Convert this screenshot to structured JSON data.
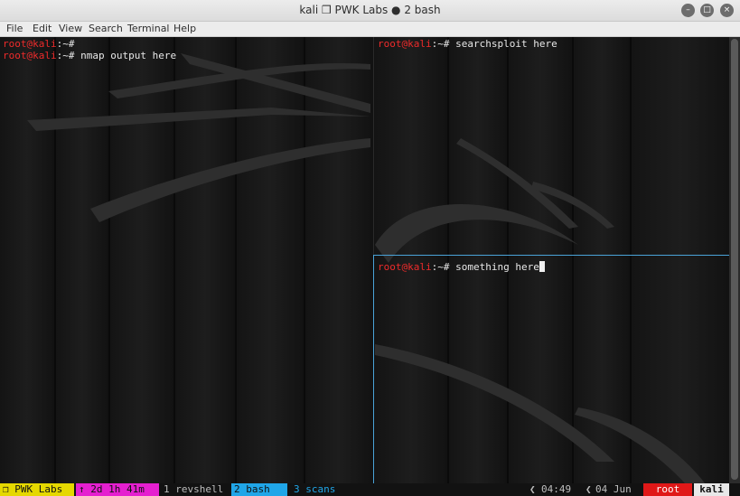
{
  "window": {
    "title": "kali ❒ PWK Labs ● 2 bash",
    "minimize_glyph": "–",
    "maximize_glyph": "□",
    "close_glyph": "×"
  },
  "menu": [
    "File",
    "Edit",
    "View",
    "Search",
    "Terminal",
    "Help"
  ],
  "panes": {
    "left": [
      {
        "prompt_user": "root@kali",
        "prompt_rest": ":~#",
        "command": ""
      },
      {
        "prompt_user": "root@kali",
        "prompt_rest": ":~#",
        "command": " nmap output here"
      }
    ],
    "top_right": [
      {
        "prompt_user": "root@kali",
        "prompt_rest": ":~#",
        "command": " searchsploit here"
      }
    ],
    "bottom_right": [
      {
        "prompt_user": "root@kali",
        "prompt_rest": ":~#",
        "command": " something here"
      }
    ]
  },
  "statusbar": {
    "session": "❒ PWK Labs",
    "uptime": "↑ 2d 1h 41m",
    "windows": [
      "1 revshell",
      "2 bash",
      "3 scans"
    ],
    "time": "04:49",
    "date": "04 Jun",
    "user": "root",
    "host": "kali"
  },
  "colors": {
    "prompt": "#ee2b2b",
    "session_bg": "#e5d800",
    "uptime_bg": "#e51fd0",
    "active_window_bg": "#20a6e8",
    "user_bg": "#e01818",
    "host_bg": "#e8e8e8",
    "active_pane_border": "#4aa3d8"
  }
}
